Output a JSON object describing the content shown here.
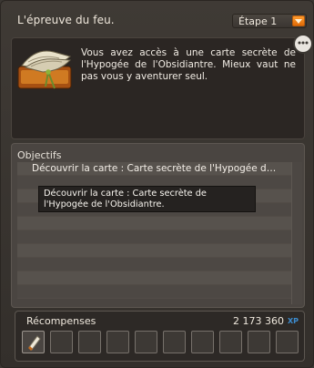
{
  "window": {
    "title": "L'épreuve du feu."
  },
  "stage_selector": {
    "selected": "Étape 1",
    "accent": "#f07b12"
  },
  "description": {
    "text": "Vous avez accès à une carte secrète de l'Hypogée de l'Obsidiantre. Mieux vaut ne pas vous y aventurer seul."
  },
  "objectives": {
    "header": "Objectifs",
    "items": [
      "Découvrir la carte : Carte secrète de l'Hypogée d…"
    ],
    "tooltip": "Découvrir la carte : Carte secrète de l'Hypogée de l'Obsidiantre."
  },
  "rewards": {
    "label": "Récompenses",
    "xp_value": "2 173 360",
    "xp_unit": "XP",
    "item_icon": "scroll-icon"
  },
  "icons": {
    "intro": "scroll-book-icon",
    "more": "more-icon",
    "dropdown": "chevron-down-icon"
  }
}
